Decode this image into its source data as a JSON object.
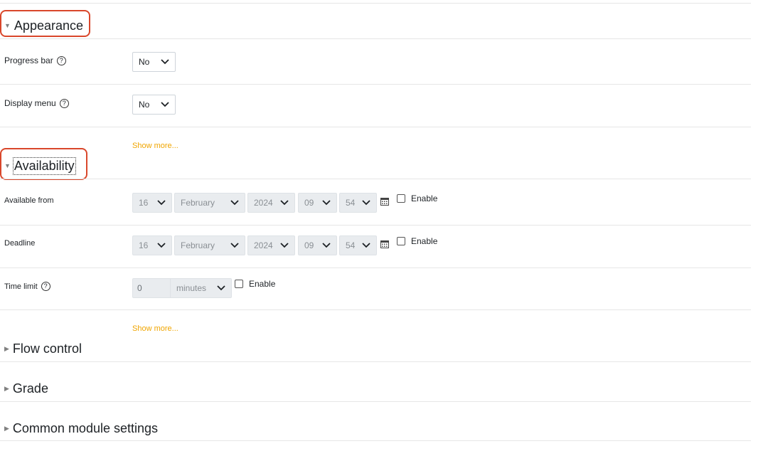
{
  "sections": {
    "appearance": {
      "label": "Appearance"
    },
    "availability": {
      "label": "Availability"
    },
    "flow_control": {
      "label": "Flow control"
    },
    "grade": {
      "label": "Grade"
    },
    "common_module": {
      "label": "Common module settings"
    }
  },
  "appearance": {
    "progress_bar": {
      "label": "Progress bar",
      "value": "No"
    },
    "display_menu": {
      "label": "Display menu",
      "value": "No"
    },
    "show_more": "Show more..."
  },
  "availability": {
    "available_from": {
      "label": "Available from",
      "day": "16",
      "month": "February",
      "year": "2024",
      "hour": "09",
      "minute": "54",
      "enable_label": "Enable"
    },
    "deadline": {
      "label": "Deadline",
      "day": "16",
      "month": "February",
      "year": "2024",
      "hour": "09",
      "minute": "54",
      "enable_label": "Enable"
    },
    "time_limit": {
      "label": "Time limit",
      "value": "0",
      "unit": "minutes",
      "enable_label": "Enable"
    },
    "show_more": "Show more..."
  },
  "icons": {
    "help": "help-icon",
    "calendar": "calendar-icon",
    "collapse": "triangle-down-icon",
    "expand": "triangle-right-icon"
  },
  "colors": {
    "highlight": "#d9472b",
    "link": "#f0a500"
  }
}
